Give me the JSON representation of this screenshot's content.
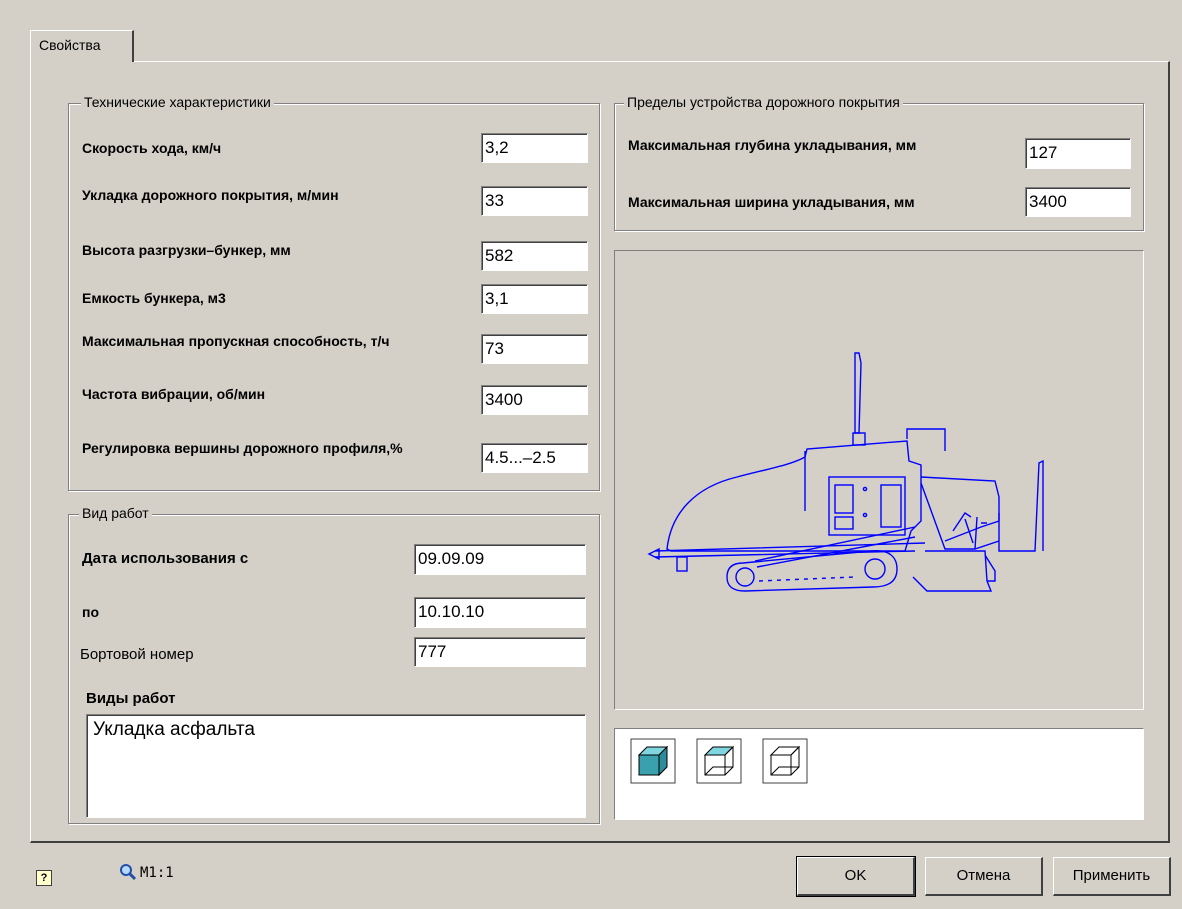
{
  "tab": {
    "label": "Свойства"
  },
  "tech": {
    "legend": "Технические характеристики",
    "fields": [
      {
        "label": "Скорость хода, км/ч",
        "value": "3,2"
      },
      {
        "label": "Укладка дорожного покрытия, м/мин",
        "value": "33"
      },
      {
        "label": "Высота разгрузки–бункер, мм",
        "value": "582"
      },
      {
        "label": "Емкость бункера, м3",
        "value": "3,1"
      },
      {
        "label": "Максимальная пропускная способность, т/ч",
        "value": "73"
      },
      {
        "label": "Частота вибрации, об/мин",
        "value": "3400"
      },
      {
        "label": "Регулировка вершины дорожного профиля,%",
        "value": "4.5...–2.5"
      }
    ]
  },
  "limits": {
    "legend": "Пределы устройства дорожного покрытия",
    "depth_label": "Максимальная глубина укладывания, мм",
    "depth_value": "127",
    "width_label": "Максимальная ширина укладывания, мм",
    "width_value": "3400"
  },
  "work": {
    "legend": "Вид работ",
    "date_from_label": "Дата использования с",
    "date_from_value": "09.09.09",
    "date_to_label": "по",
    "date_to_value": "10.10.10",
    "board_label": "Бортовой номер",
    "board_value": "777",
    "types_label": "Виды работ",
    "types_value": "Укладка асфальта"
  },
  "footer": {
    "help_icon": "help-icon",
    "zoom_icon": "magnifier-icon",
    "scale": "M1:1",
    "ok": "OK",
    "cancel": "Отмена",
    "apply": "Применить"
  },
  "colors": {
    "drawing": "#0000ff",
    "cube_fill": "#3aa0ad",
    "cube_light": "#7fd6e0"
  }
}
